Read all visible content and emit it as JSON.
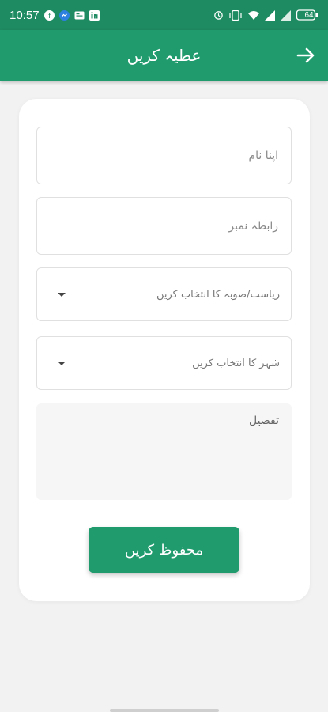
{
  "status_bar": {
    "time": "10:57",
    "battery": "64",
    "left_icons": [
      "facebook-icon",
      "messenger-icon",
      "news-icon",
      "linkedin-icon"
    ],
    "right_icons": [
      "alarm-icon",
      "vibrate-icon",
      "wifi-icon",
      "signal-icon",
      "battery-icon"
    ]
  },
  "appbar": {
    "title": "عطیہ کریں",
    "back_icon": "arrow-right-icon"
  },
  "form": {
    "name_placeholder": "اپنا نام",
    "phone_placeholder": "رابطہ نمبر",
    "state_select": "ریاست/صوبہ کا انتخاب کریں",
    "city_select": "شہر کا انتخاب کریں",
    "details_placeholder": "تفصیل",
    "save_label": "محفوظ کریں"
  },
  "colors": {
    "primary": "#1f9b6e",
    "status_bar": "#1f8b62",
    "background": "#f2f2f2"
  }
}
